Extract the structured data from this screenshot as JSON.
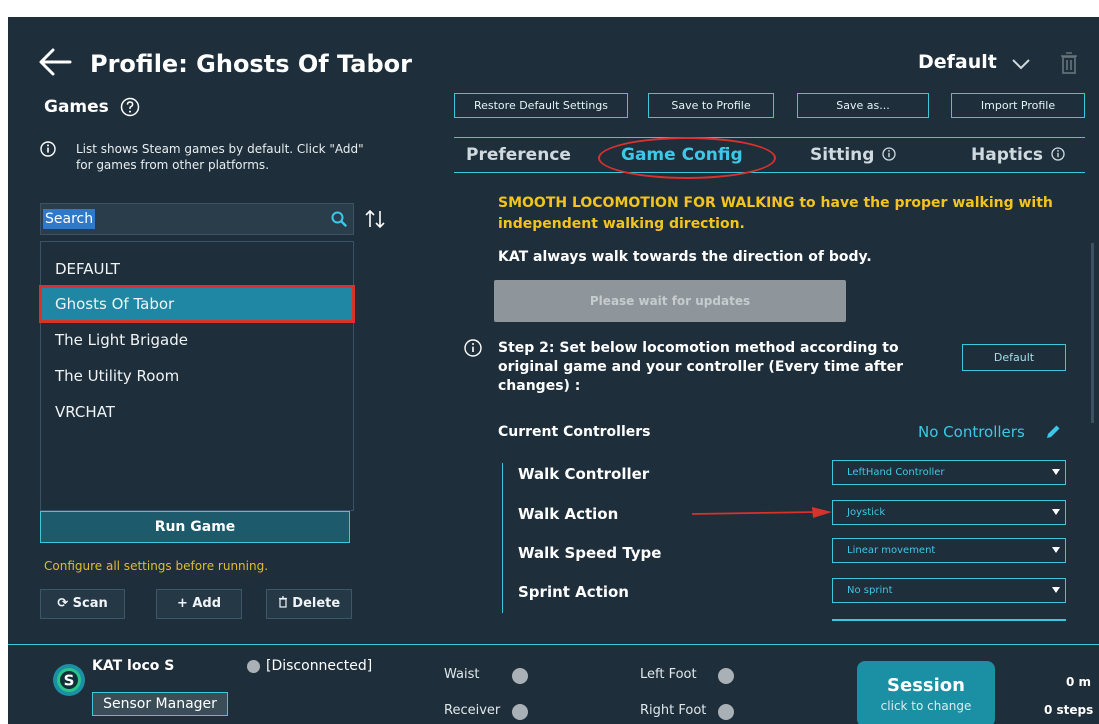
{
  "header": {
    "title": "Profile: Ghosts Of Tabor",
    "profile_selected": "Default"
  },
  "games": {
    "title": "Games",
    "info": "List shows Steam games by default.  Click \"Add\" for games from other platforms.",
    "search_value": "Search",
    "list": [
      {
        "label": "DEFAULT"
      },
      {
        "label": "Ghosts Of Tabor"
      },
      {
        "label": "The Light Brigade"
      },
      {
        "label": "The Utility Room"
      },
      {
        "label": "VRCHAT"
      }
    ],
    "run_game": "Run Game",
    "configure_note": "Configure all settings before running.",
    "scan": "Scan",
    "add": "Add",
    "delete": "Delete"
  },
  "toolbar": {
    "restore": "Restore Default Settings",
    "save_profile": "Save to Profile",
    "save_as": "Save as...",
    "import": "Import Profile"
  },
  "tabs": [
    {
      "label": "Preference"
    },
    {
      "label": "Game Config"
    },
    {
      "label": "Sitting"
    },
    {
      "label": "Haptics"
    }
  ],
  "config": {
    "warning": "SMOOTH LOCOMOTION FOR WALKING to have the proper walking with independent walking direction.",
    "kat_walk": "KAT always walk towards the direction of body.",
    "wait_button": "Please wait for updates",
    "step2": "Step 2: Set below locomotion method according to original game and your controller (Every time after changes) :",
    "default_button": "Default",
    "current_controllers": "Current Controllers",
    "no_controllers": "No Controllers",
    "rows": [
      {
        "label": "Walk Controller",
        "value": "LeftHand Controller"
      },
      {
        "label": "Walk Action",
        "value": "Joystick"
      },
      {
        "label": "Walk Speed Type",
        "value": "Linear movement"
      },
      {
        "label": "Sprint Action",
        "value": "No sprint"
      }
    ]
  },
  "status": {
    "device": "KAT loco S",
    "sensor_manager": "Sensor Manager",
    "connection": "[Disconnected]",
    "waist": "Waist",
    "receiver": "Receiver",
    "left_foot": "Left Foot",
    "right_foot": "Right Foot",
    "session": "Session",
    "session_sub": "click to change",
    "distance": "0 m",
    "steps": "0 steps"
  },
  "colors": {
    "background": "#1e2e3a",
    "accent": "#3dc7de",
    "active_tab": "#3ec8e8",
    "warning": "#f2c41c",
    "highlight": "#d8322c"
  }
}
